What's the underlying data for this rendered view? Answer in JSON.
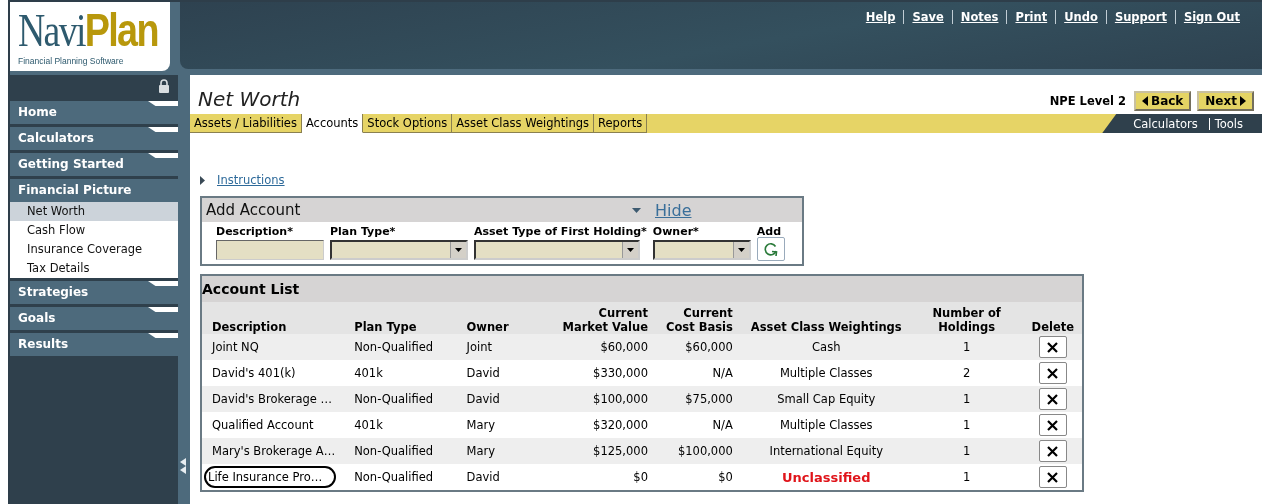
{
  "logo": {
    "part_1": "Navi",
    "part_2": "Plan",
    "tagline": "Financial Planning Software"
  },
  "top_links": [
    "Help",
    "Save",
    "Notes",
    "Print",
    "Undo",
    "Support",
    "Sign Out"
  ],
  "sidebar": {
    "items": [
      {
        "label": "Home",
        "expanded": false
      },
      {
        "label": "Calculators",
        "expanded": false
      },
      {
        "label": "Getting Started",
        "expanded": false
      },
      {
        "label": "Financial Picture",
        "expanded": true,
        "children": [
          {
            "label": "Net Worth",
            "selected": true
          },
          {
            "label": "Cash Flow",
            "selected": false
          },
          {
            "label": "Insurance Coverage",
            "selected": false
          },
          {
            "label": "Tax Details",
            "selected": false
          }
        ]
      },
      {
        "label": "Strategies",
        "expanded": false
      },
      {
        "label": "Goals",
        "expanded": false
      },
      {
        "label": "Results",
        "expanded": false
      }
    ]
  },
  "page_title": "Net Worth",
  "level": "NPE Level 2",
  "nav_buttons": [
    {
      "kind": "back",
      "label": "Back"
    },
    {
      "kind": "next",
      "label": "Next"
    }
  ],
  "tabs": [
    {
      "label": "Assets / Liabilities",
      "selected": false
    },
    {
      "label": "Accounts",
      "selected": true
    },
    {
      "label": "Stock Options",
      "selected": false
    },
    {
      "label": "Asset Class Weightings",
      "selected": false
    },
    {
      "label": "Reports",
      "selected": false
    }
  ],
  "tool_links": [
    "Calculators",
    "Tools"
  ],
  "instructions_link": "Instructions",
  "add_account": {
    "title": "Add Account",
    "hide_link": "Hide",
    "fields": [
      {
        "label": "Description*",
        "kind": "text"
      },
      {
        "label": "Plan Type*",
        "kind": "select"
      },
      {
        "label": "Asset Type of First Holding*",
        "kind": "select"
      },
      {
        "label": "Owner*",
        "kind": "select"
      }
    ],
    "add_label": "Add"
  },
  "account_list": {
    "title": "Account List",
    "columns": [
      "Description",
      "Plan Type",
      "Owner",
      "Current\nMarket Value",
      "Current\nCost Basis",
      "Asset Class Weightings",
      "Number of\nHoldings",
      "Delete"
    ],
    "rows": [
      {
        "cells": [
          "Joint NQ",
          "Non-Qualified",
          "Joint",
          "$60,000",
          "$60,000",
          "Cash",
          "1"
        ],
        "circled": false,
        "flagged": false
      },
      {
        "cells": [
          "David's 401(k)",
          "401k",
          "David",
          "$330,000",
          "N/A",
          "Multiple Classes",
          "2"
        ],
        "circled": false,
        "flagged": false
      },
      {
        "cells": [
          "David's Brokerage …",
          "Non-Qualified",
          "David",
          "$100,000",
          "$75,000",
          "Small Cap Equity",
          "1"
        ],
        "circled": false,
        "flagged": false
      },
      {
        "cells": [
          "Qualified Account",
          "401k",
          "Mary",
          "$320,000",
          "N/A",
          "Multiple Classes",
          "1"
        ],
        "circled": false,
        "flagged": false
      },
      {
        "cells": [
          "Mary's Brokerage A…",
          "Non-Qualified",
          "Mary",
          "$125,000",
          "$100,000",
          "International Equity",
          "1"
        ],
        "circled": false,
        "flagged": false
      },
      {
        "cells": [
          "Life Insurance Pro…",
          "Non-Qualified",
          "David",
          "$0",
          "$0",
          "Unclassified",
          "1"
        ],
        "circled": true,
        "flagged": true
      }
    ]
  }
}
